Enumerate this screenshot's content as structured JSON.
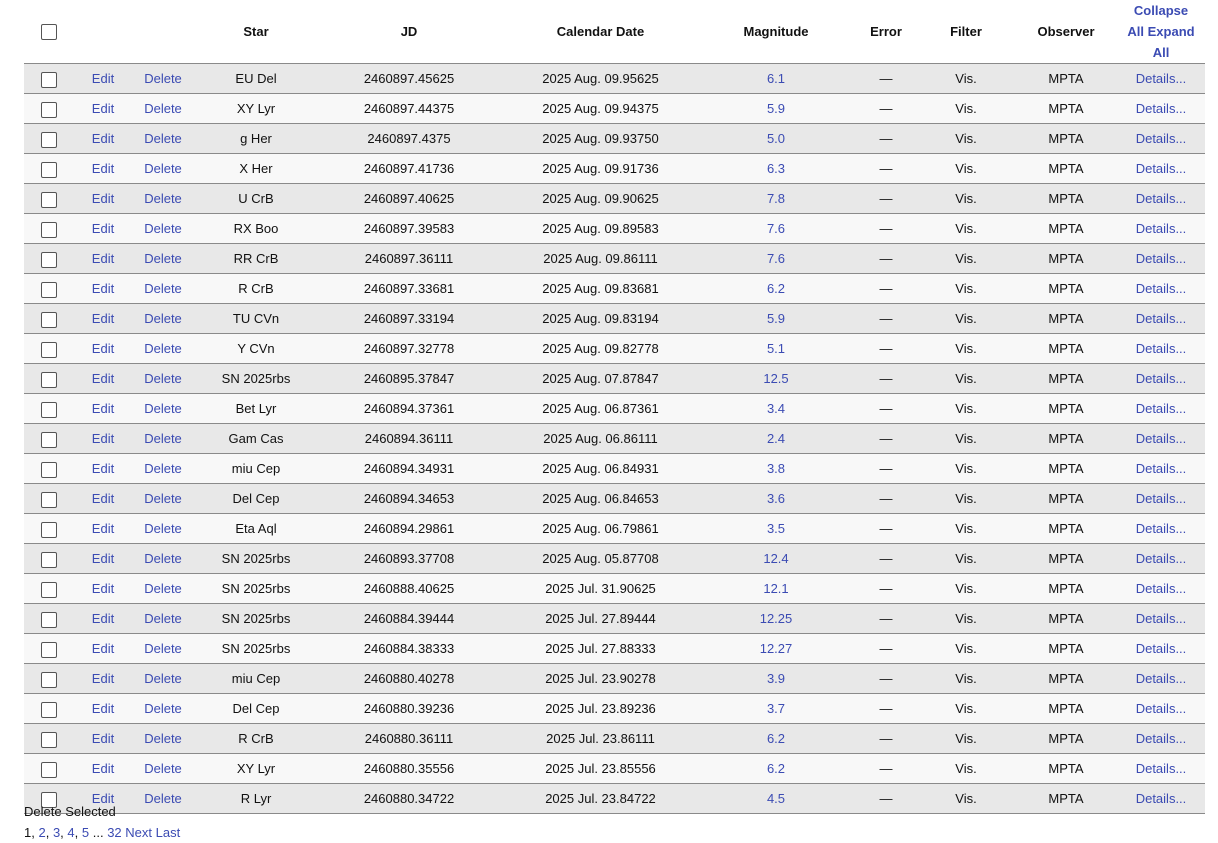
{
  "header": {
    "star": "Star",
    "jd": "JD",
    "date": "Calendar Date",
    "magnitude": "Magnitude",
    "error": "Error",
    "filter": "Filter",
    "observer": "Observer",
    "collapse_line1": "Collapse",
    "collapse_line2": "All Expand",
    "collapse_line3": "All"
  },
  "row_labels": {
    "edit": "Edit",
    "delete": "Delete",
    "details": "Details..."
  },
  "rows": [
    {
      "star": "EU Del",
      "jd": "2460897.45625",
      "date": "2025 Aug. 09.95625",
      "mag": "6.1",
      "error": "—",
      "filter": "Vis.",
      "observer": "MPTA"
    },
    {
      "star": "XY Lyr",
      "jd": "2460897.44375",
      "date": "2025 Aug. 09.94375",
      "mag": "5.9",
      "error": "—",
      "filter": "Vis.",
      "observer": "MPTA"
    },
    {
      "star": "g Her",
      "jd": "2460897.4375",
      "date": "2025 Aug. 09.93750",
      "mag": "5.0",
      "error": "—",
      "filter": "Vis.",
      "observer": "MPTA"
    },
    {
      "star": "X Her",
      "jd": "2460897.41736",
      "date": "2025 Aug. 09.91736",
      "mag": "6.3",
      "error": "—",
      "filter": "Vis.",
      "observer": "MPTA"
    },
    {
      "star": "U CrB",
      "jd": "2460897.40625",
      "date": "2025 Aug. 09.90625",
      "mag": "7.8",
      "error": "—",
      "filter": "Vis.",
      "observer": "MPTA"
    },
    {
      "star": "RX Boo",
      "jd": "2460897.39583",
      "date": "2025 Aug. 09.89583",
      "mag": "7.6",
      "error": "—",
      "filter": "Vis.",
      "observer": "MPTA"
    },
    {
      "star": "RR CrB",
      "jd": "2460897.36111",
      "date": "2025 Aug. 09.86111",
      "mag": "7.6",
      "error": "—",
      "filter": "Vis.",
      "observer": "MPTA"
    },
    {
      "star": "R CrB",
      "jd": "2460897.33681",
      "date": "2025 Aug. 09.83681",
      "mag": "6.2",
      "error": "—",
      "filter": "Vis.",
      "observer": "MPTA"
    },
    {
      "star": "TU CVn",
      "jd": "2460897.33194",
      "date": "2025 Aug. 09.83194",
      "mag": "5.9",
      "error": "—",
      "filter": "Vis.",
      "observer": "MPTA"
    },
    {
      "star": "Y CVn",
      "jd": "2460897.32778",
      "date": "2025 Aug. 09.82778",
      "mag": "5.1",
      "error": "—",
      "filter": "Vis.",
      "observer": "MPTA"
    },
    {
      "star": "SN 2025rbs",
      "jd": "2460895.37847",
      "date": "2025 Aug. 07.87847",
      "mag": "12.5",
      "error": "—",
      "filter": "Vis.",
      "observer": "MPTA"
    },
    {
      "star": "Bet Lyr",
      "jd": "2460894.37361",
      "date": "2025 Aug. 06.87361",
      "mag": "3.4",
      "error": "—",
      "filter": "Vis.",
      "observer": "MPTA"
    },
    {
      "star": "Gam Cas",
      "jd": "2460894.36111",
      "date": "2025 Aug. 06.86111",
      "mag": "2.4",
      "error": "—",
      "filter": "Vis.",
      "observer": "MPTA"
    },
    {
      "star": "miu Cep",
      "jd": "2460894.34931",
      "date": "2025 Aug. 06.84931",
      "mag": "3.8",
      "error": "—",
      "filter": "Vis.",
      "observer": "MPTA"
    },
    {
      "star": "Del Cep",
      "jd": "2460894.34653",
      "date": "2025 Aug. 06.84653",
      "mag": "3.6",
      "error": "—",
      "filter": "Vis.",
      "observer": "MPTA"
    },
    {
      "star": "Eta Aql",
      "jd": "2460894.29861",
      "date": "2025 Aug. 06.79861",
      "mag": "3.5",
      "error": "—",
      "filter": "Vis.",
      "observer": "MPTA"
    },
    {
      "star": "SN 2025rbs",
      "jd": "2460893.37708",
      "date": "2025 Aug. 05.87708",
      "mag": "12.4",
      "error": "—",
      "filter": "Vis.",
      "observer": "MPTA"
    },
    {
      "star": "SN 2025rbs",
      "jd": "2460888.40625",
      "date": "2025 Jul. 31.90625",
      "mag": "12.1",
      "error": "—",
      "filter": "Vis.",
      "observer": "MPTA"
    },
    {
      "star": "SN 2025rbs",
      "jd": "2460884.39444",
      "date": "2025 Jul. 27.89444",
      "mag": "12.25",
      "error": "—",
      "filter": "Vis.",
      "observer": "MPTA"
    },
    {
      "star": "SN 2025rbs",
      "jd": "2460884.38333",
      "date": "2025 Jul. 27.88333",
      "mag": "12.27",
      "error": "—",
      "filter": "Vis.",
      "observer": "MPTA"
    },
    {
      "star": "miu Cep",
      "jd": "2460880.40278",
      "date": "2025 Jul. 23.90278",
      "mag": "3.9",
      "error": "—",
      "filter": "Vis.",
      "observer": "MPTA"
    },
    {
      "star": "Del Cep",
      "jd": "2460880.39236",
      "date": "2025 Jul. 23.89236",
      "mag": "3.7",
      "error": "—",
      "filter": "Vis.",
      "observer": "MPTA"
    },
    {
      "star": "R CrB",
      "jd": "2460880.36111",
      "date": "2025 Jul. 23.86111",
      "mag": "6.2",
      "error": "—",
      "filter": "Vis.",
      "observer": "MPTA"
    },
    {
      "star": "XY Lyr",
      "jd": "2460880.35556",
      "date": "2025 Jul. 23.85556",
      "mag": "6.2",
      "error": "—",
      "filter": "Vis.",
      "observer": "MPTA"
    },
    {
      "star": "R Lyr",
      "jd": "2460880.34722",
      "date": "2025 Jul. 23.84722",
      "mag": "4.5",
      "error": "—",
      "filter": "Vis.",
      "observer": "MPTA"
    }
  ],
  "footer": {
    "delete_selected": "Delete Selected",
    "pagination": {
      "current": "1",
      "pages": [
        "2",
        "3",
        "4",
        "5"
      ],
      "ellipsis": "...",
      "last_page": "32",
      "next": "Next",
      "last": "Last"
    }
  },
  "colors": {
    "link": "#3b4bb3",
    "row_odd": "#e8e8e8",
    "row_even": "#f8f8f8"
  }
}
